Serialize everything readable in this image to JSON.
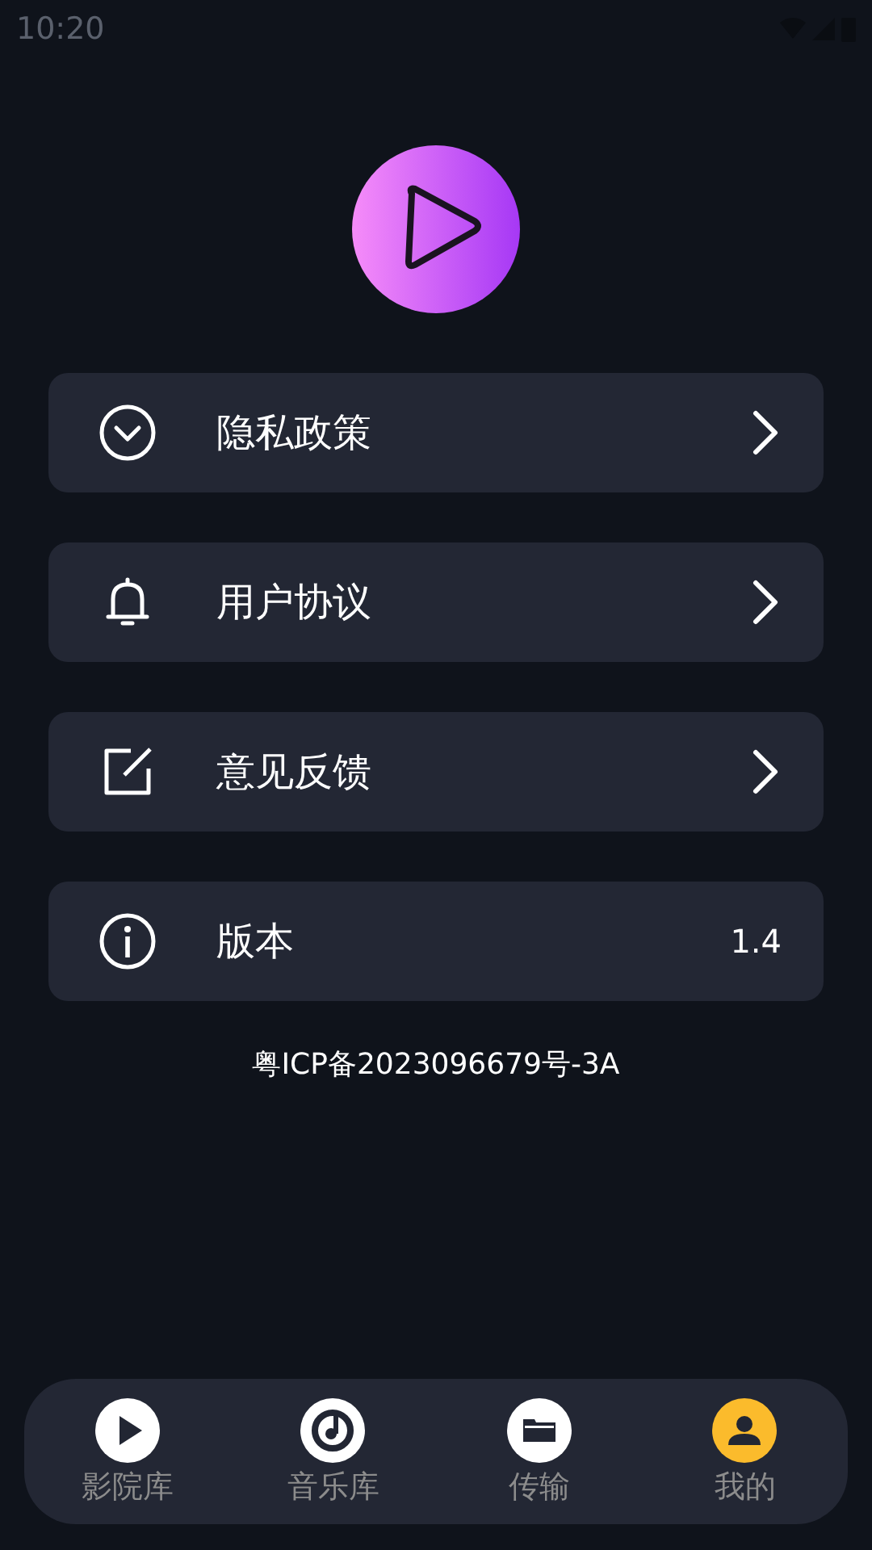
{
  "status_bar": {
    "time": "10:20"
  },
  "menu": [
    {
      "label": "隐私政策",
      "kind": "link"
    },
    {
      "label": "用户协议",
      "kind": "link"
    },
    {
      "label": "意见反馈",
      "kind": "link"
    },
    {
      "label": "版本",
      "kind": "value",
      "value": "1.4"
    }
  ],
  "footer": "粤ICP备2023096679号-3A",
  "tabs": [
    {
      "label": "影院库",
      "selected": false
    },
    {
      "label": "音乐库",
      "selected": false
    },
    {
      "label": "传输",
      "selected": false
    },
    {
      "label": "我的",
      "selected": true
    }
  ]
}
